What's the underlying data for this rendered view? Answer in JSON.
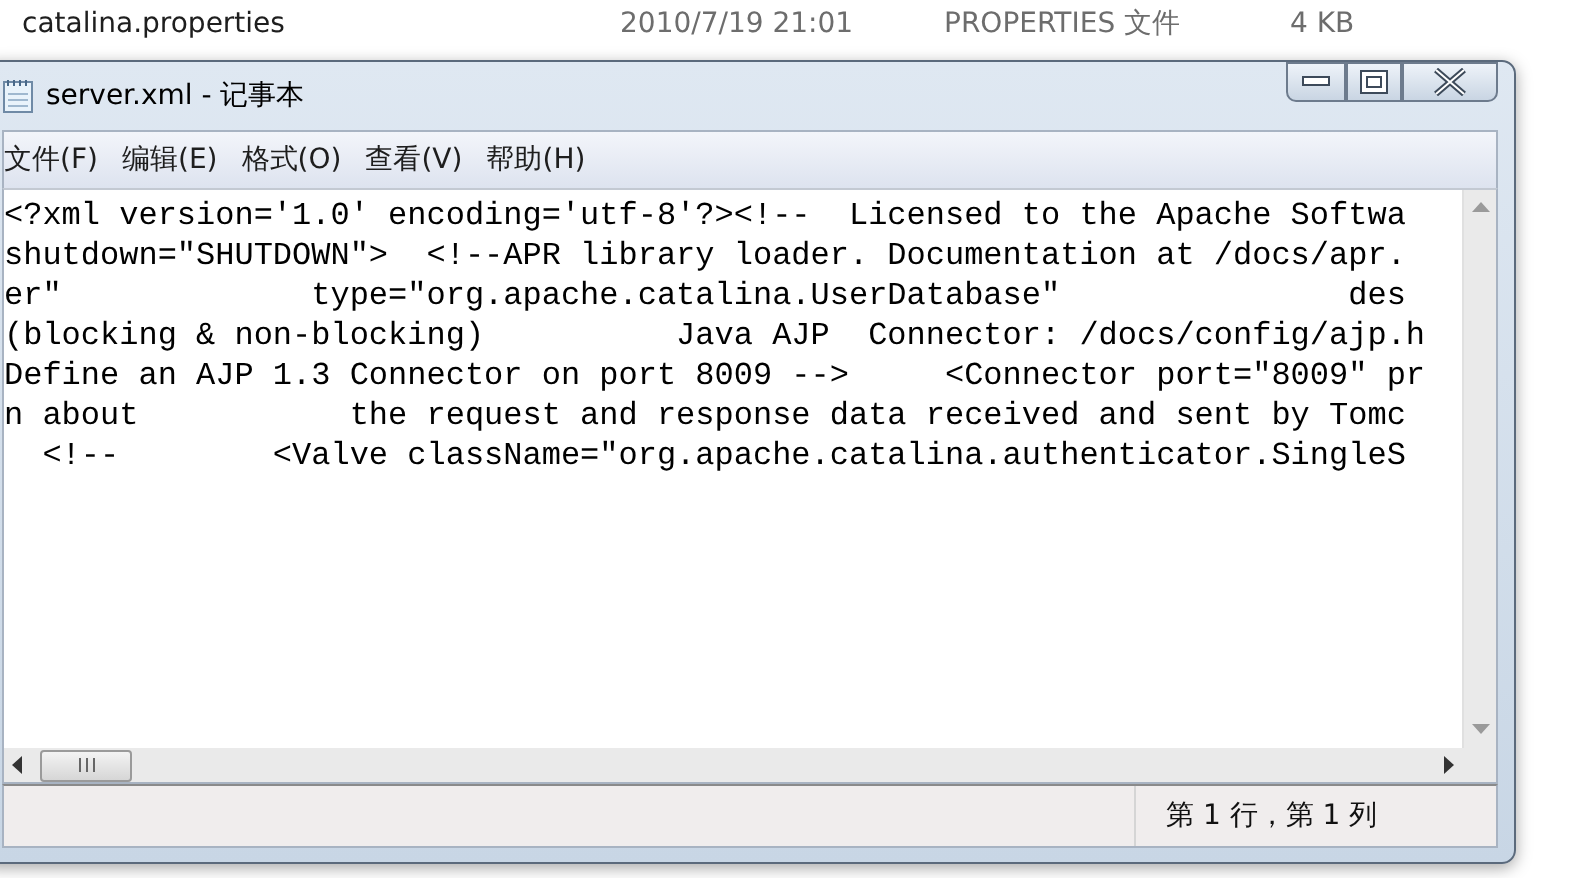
{
  "explorer_row": {
    "name": "catalina.properties",
    "modified": "2010/7/19 21:01",
    "type": "PROPERTIES 文件",
    "size": "4 KB"
  },
  "window": {
    "title": "server.xml - 记事本"
  },
  "menu": [
    "文件(F)",
    "编辑(E)",
    "格式(O)",
    "查看(V)",
    "帮助(H)"
  ],
  "editor": {
    "lines": [
      "<?xml version='1.0' encoding='utf-8'?><!--  Licensed to the Apache Softwa",
      "shutdown=\"SHUTDOWN\">  <!--APR library loader. Documentation at /docs/apr.",
      "er\"             type=\"org.apache.catalina.UserDatabase\"               des",
      "(blocking & non-blocking)          Java AJP  Connector: /docs/config/ajp.h",
      "Define an AJP 1.3 Connector on port 8009 -->     <Connector port=\"8009\" pr",
      "n about           the request and response data received and sent by Tomc",
      "  <!--        <Valve className=\"org.apache.catalina.authenticator.SingleS"
    ]
  },
  "status_bar": {
    "position": "第 1 行，第 1 列"
  }
}
